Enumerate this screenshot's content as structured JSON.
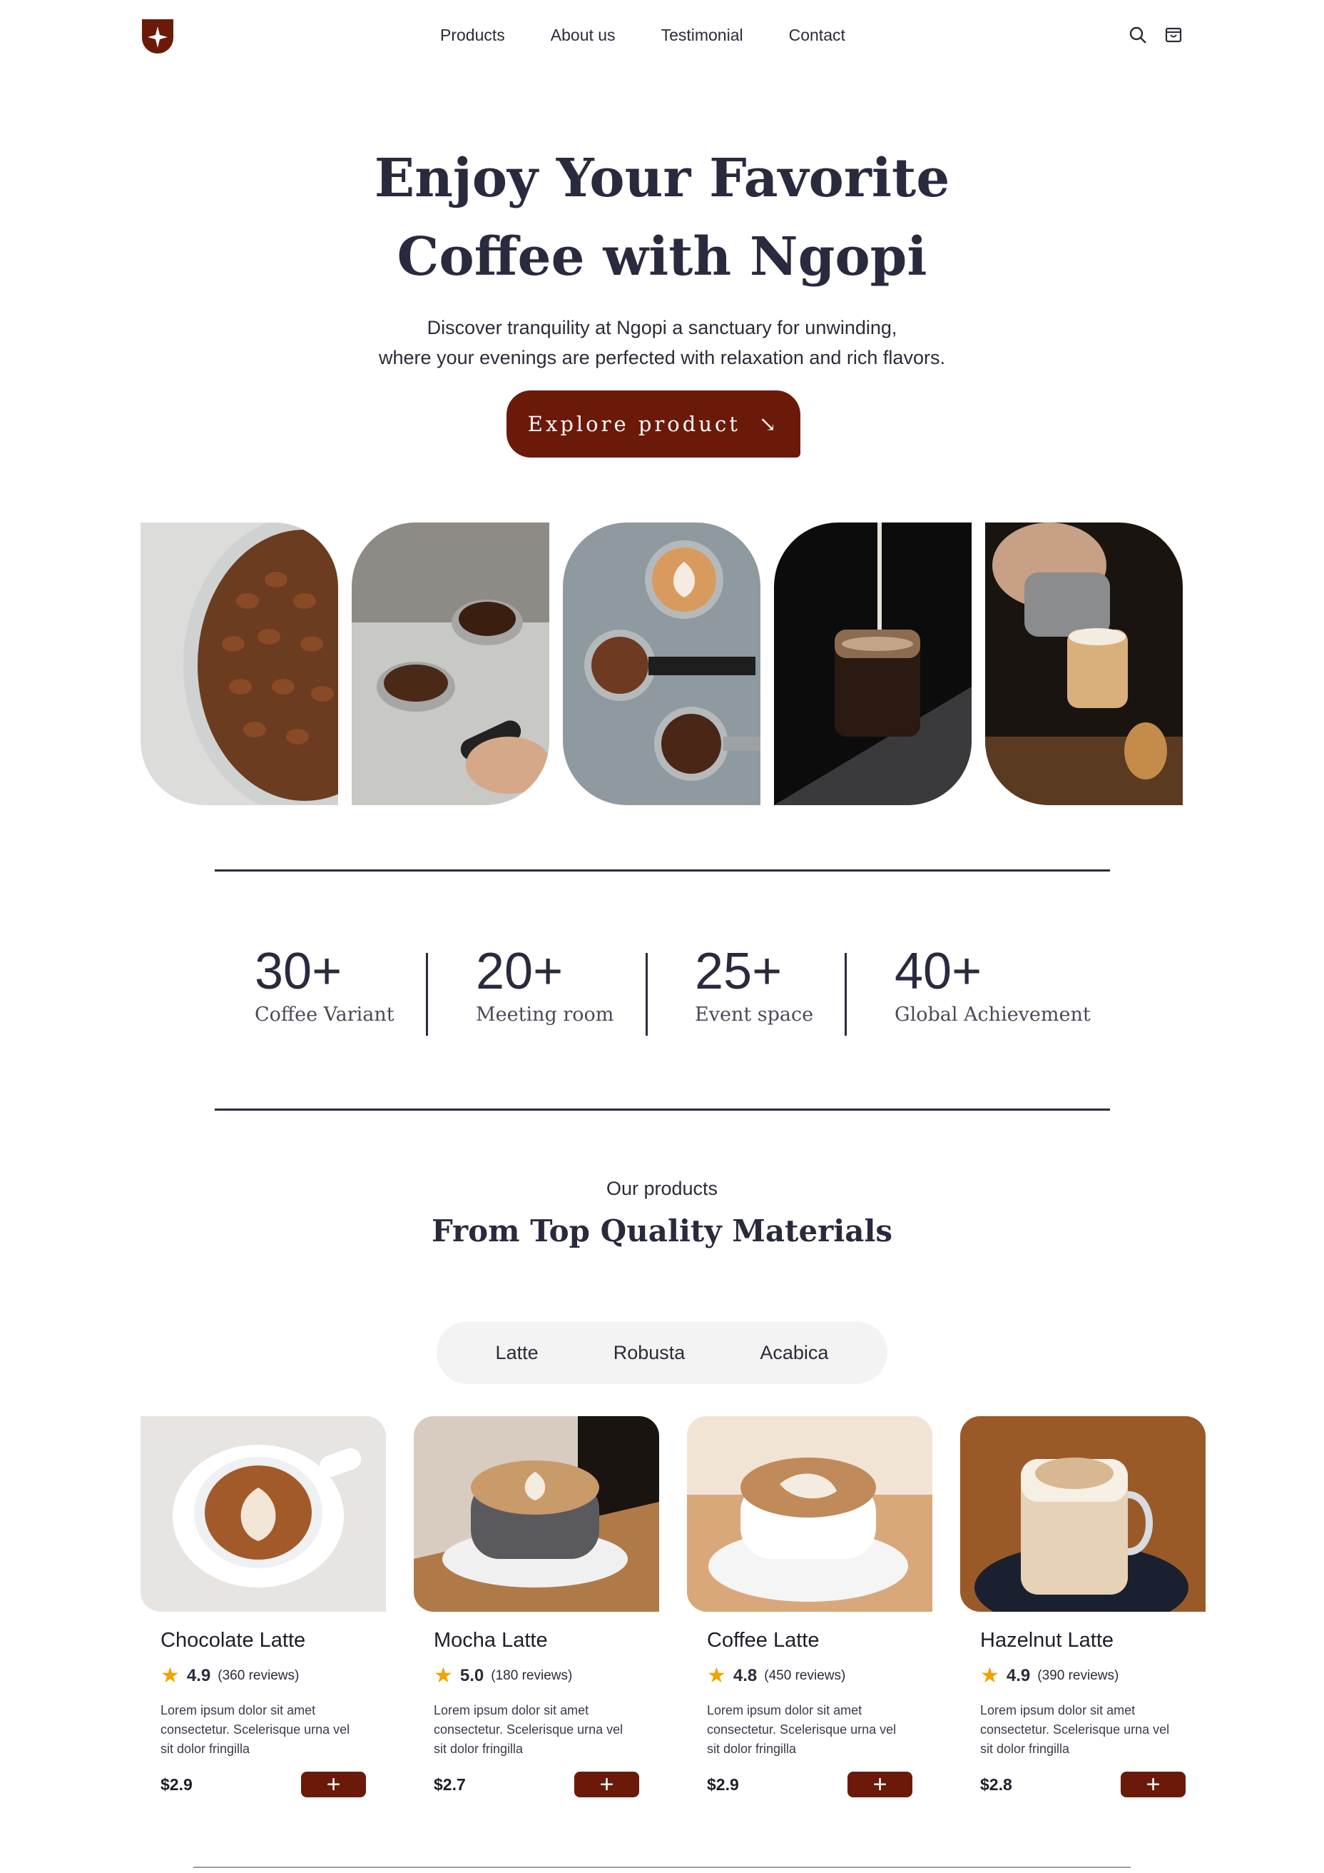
{
  "brand": {
    "accent": "#6b1a0a",
    "text": "#2a2a3e"
  },
  "nav": {
    "links": [
      "Products",
      "About us",
      "Testimonial",
      "Contact"
    ],
    "icons": [
      "search-icon",
      "cart-icon"
    ]
  },
  "hero": {
    "title_line1": "Enjoy Your Favorite",
    "title_line2": "Coffee with Ngopi",
    "sub_line1": "Discover tranquility at Ngopi a sanctuary for unwinding,",
    "sub_line2": "where your evenings are perfected with relaxation and rich flavors.",
    "cta_label": "Explore product",
    "cta_icon": "↘"
  },
  "stats": [
    {
      "value": "30+",
      "label": "Coffee Variant"
    },
    {
      "value": "20+",
      "label": "Meeting room"
    },
    {
      "value": "25+",
      "label": "Event space"
    },
    {
      "value": "40+",
      "label": "Global Achievement"
    }
  ],
  "products": {
    "eyebrow": "Our products",
    "title": "From Top Quality Materials",
    "tabs": [
      "Latte",
      "Robusta",
      "Acabica"
    ],
    "items": [
      {
        "name": "Chocolate Latte",
        "rating": "4.9",
        "reviews": "(360 reviews)",
        "desc": "Lorem ipsum dolor sit amet consectetur. Scelerisque urna vel sit dolor fringilla",
        "price": "$2.9",
        "add": "+"
      },
      {
        "name": "Mocha Latte",
        "rating": "5.0",
        "reviews": "(180 reviews)",
        "desc": "Lorem ipsum dolor sit amet consectetur. Scelerisque urna vel sit dolor fringilla",
        "price": "$2.7",
        "add": "+"
      },
      {
        "name": "Coffee Latte",
        "rating": "4.8",
        "reviews": "(450 reviews)",
        "desc": "Lorem ipsum dolor sit amet consectetur. Scelerisque urna vel sit dolor fringilla",
        "price": "$2.9",
        "add": "+"
      },
      {
        "name": "Hazelnut Latte",
        "rating": "4.9",
        "reviews": "(390 reviews)",
        "desc": "Lorem ipsum dolor sit amet consectetur. Scelerisque urna vel sit dolor fringilla",
        "price": "$2.8",
        "add": "+"
      }
    ]
  }
}
